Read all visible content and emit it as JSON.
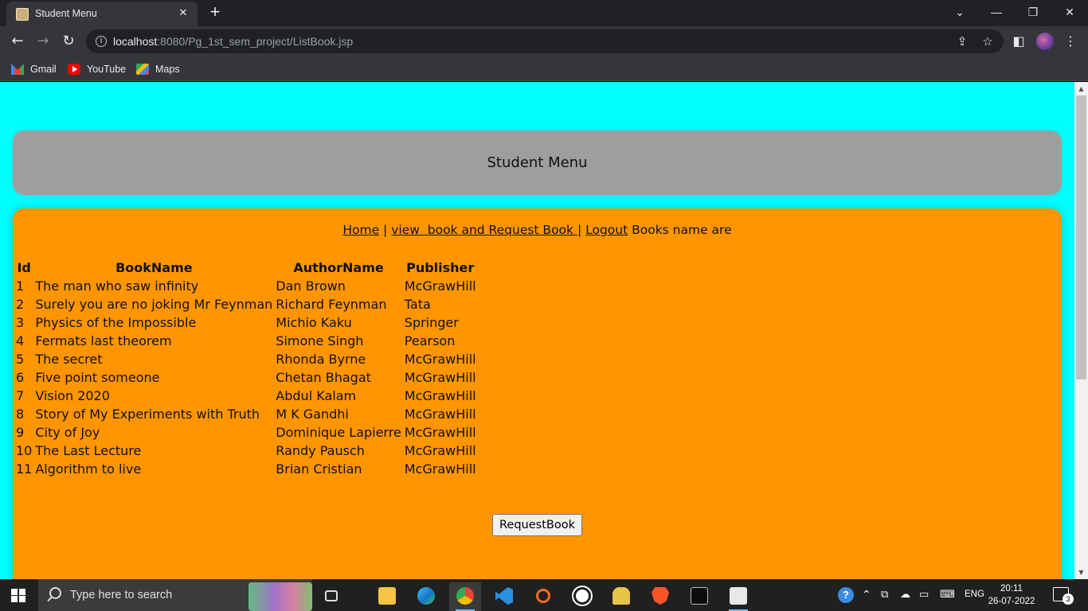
{
  "browser": {
    "tab_title": "Student Menu",
    "tab_close": "✕",
    "new_tab": "+",
    "url_host": "localhost",
    "url_rest": ":8080/Pg_1st_sem_project/ListBook.jsp",
    "bookmarks": [
      {
        "label": "Gmail",
        "icon": "gmail-icon"
      },
      {
        "label": "YouTube",
        "icon": "youtube-icon"
      },
      {
        "label": "Maps",
        "icon": "maps-icon"
      }
    ],
    "window_controls": {
      "minimize": "—",
      "maximize": "❐",
      "close": "✕"
    }
  },
  "page": {
    "header_title": "Student Menu",
    "nav": {
      "home": "Home",
      "sep1": " | ",
      "view_books": "view  book and Request Book ",
      "sep2": "| ",
      "logout": "Logout",
      "trailing": " Books name are"
    },
    "table": {
      "headers": [
        "Id",
        "BookName",
        "AuthorName",
        "Publisher"
      ],
      "rows": [
        [
          "1",
          "The man who saw infinity",
          "Dan Brown",
          "McGrawHill"
        ],
        [
          "2",
          "Surely you are no joking Mr Feynman",
          "Richard Feynman",
          "Tata"
        ],
        [
          "3",
          "Physics of the Impossible",
          "Michio Kaku",
          "Springer"
        ],
        [
          "4",
          "Fermats last theorem",
          "Simone Singh",
          "Pearson"
        ],
        [
          "5",
          "The secret",
          "Rhonda Byrne",
          "McGrawHill"
        ],
        [
          "6",
          "Five point someone",
          "Chetan Bhagat",
          "McGrawHill"
        ],
        [
          "7",
          "Vision 2020",
          "Abdul Kalam",
          "McGrawHill"
        ],
        [
          "8",
          "Story of My Experiments with Truth",
          "M K Gandhi",
          "McGrawHill"
        ],
        [
          "9",
          "City of Joy",
          "Dominique Lapierre",
          "McGrawHill"
        ],
        [
          "10",
          "The Last Lecture",
          "Randy Pausch",
          "McGrawHill"
        ],
        [
          "11",
          "Algorithm to live",
          "Brian Cristian",
          "McGrawHill"
        ]
      ]
    },
    "request_button": "RequestBook",
    "colors": {
      "page_bg": "#00ffff",
      "header_bg": "#9e9e9e",
      "main_bg": "#ff9500"
    }
  },
  "taskbar": {
    "search_placeholder": "Type here to search",
    "language": "ENG",
    "time": "20:11",
    "date": "26-07-2022",
    "notification_count": "3"
  }
}
